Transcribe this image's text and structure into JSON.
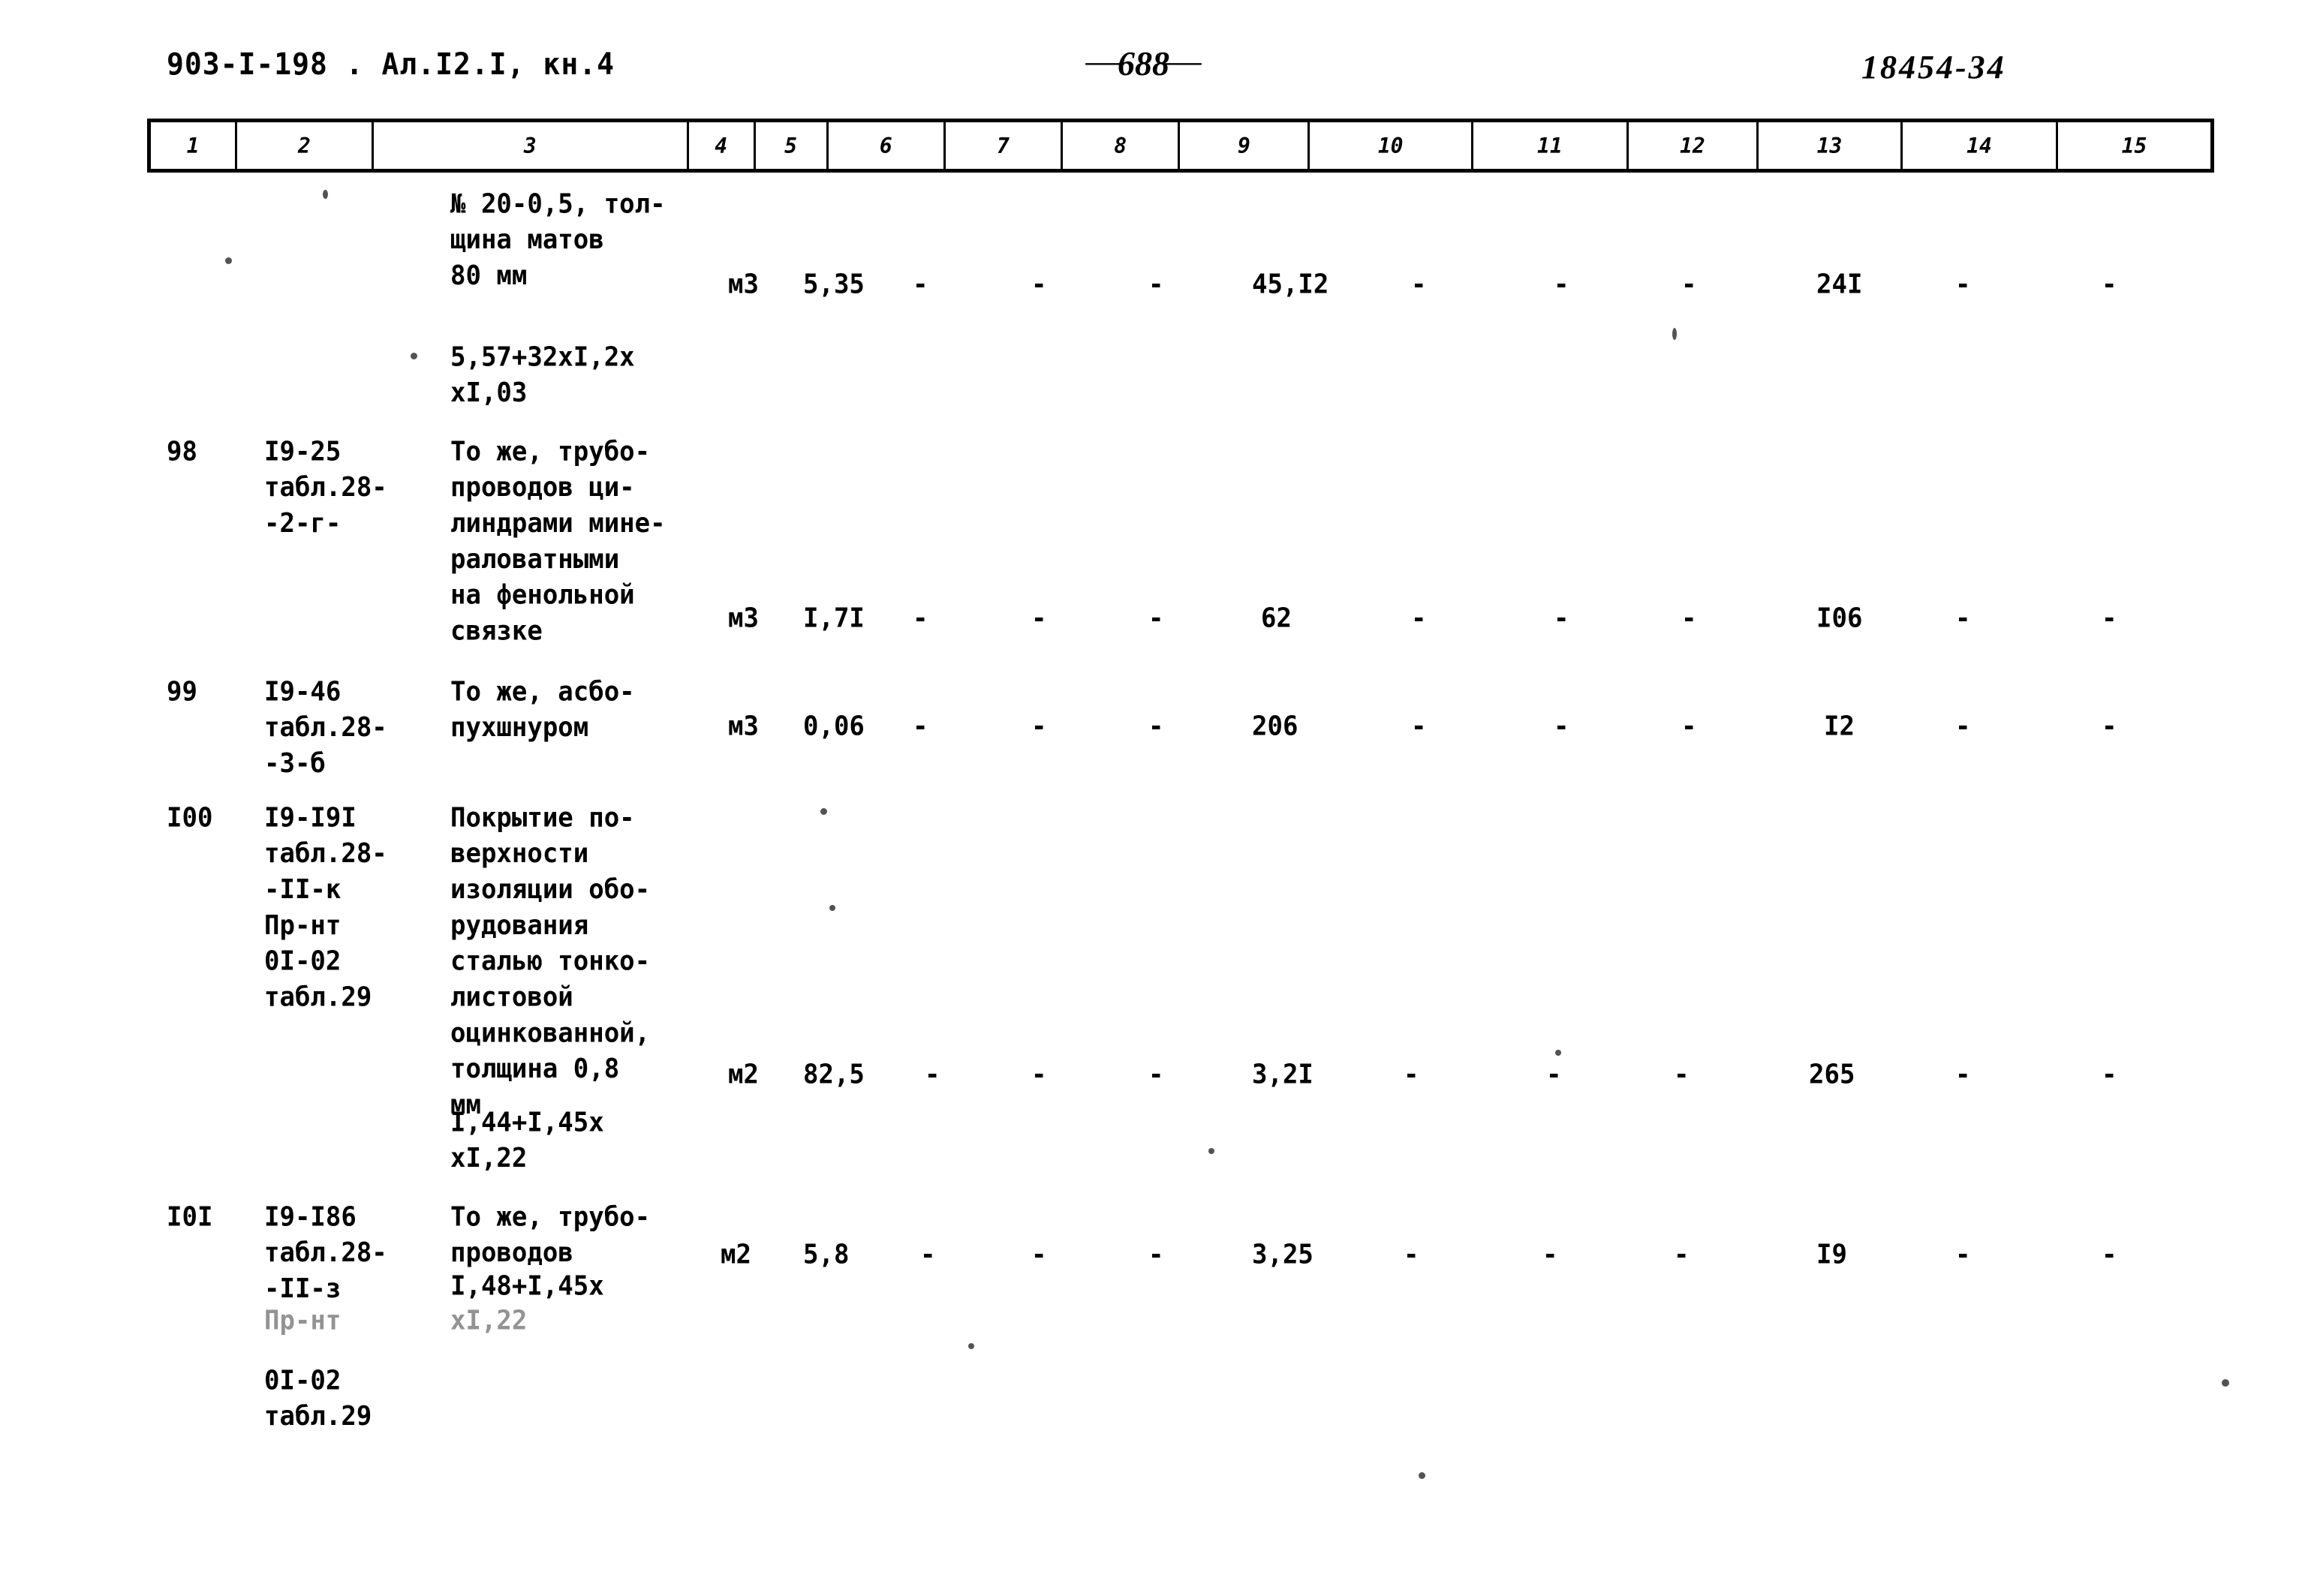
{
  "header": {
    "doc_code": "903-I-198 . Ал.I2.I, кн.4",
    "page_number": "688",
    "dash_left": "—",
    "dash_right": "—",
    "archive_stamp": "18454-34"
  },
  "table": {
    "column_headers": [
      "1",
      "2",
      "3",
      "4",
      "5",
      "6",
      "7",
      "8",
      "9",
      "10",
      "11",
      "12",
      "13",
      "14",
      "15"
    ],
    "rows": [
      {
        "num": "",
        "code": "",
        "description": "№ 20-0,5, тол-\nщина матов\n80 мм",
        "formula": "5,57+32xI,2x\nxI,03",
        "unit": "м3",
        "c5": "5,35",
        "c6": "-",
        "c7": "-",
        "c8": "-",
        "c9": "45,I2",
        "c10": "-",
        "c11": "-",
        "c12": "-",
        "c13": "24I",
        "c14": "-",
        "c15": "-"
      },
      {
        "num": "98",
        "code": "I9-25\nтабл.28-\n-2-г-",
        "description": "То же, трубо-\nпроводов ци-\nлиндрами мине-\nраловатными\nна фенольной\nсвязке",
        "formula": "",
        "unit": "м3",
        "c5": "I,7I",
        "c6": "-",
        "c7": "-",
        "c8": "-",
        "c9": "62",
        "c10": "-",
        "c11": "-",
        "c12": "-",
        "c13": "I06",
        "c14": "-",
        "c15": "-"
      },
      {
        "num": "99",
        "code": "I9-46\nтабл.28-\n-3-б",
        "description": "То же, асбо-\nпухшнуром",
        "formula": "",
        "unit": "м3",
        "c5": "0,06",
        "c6": "-",
        "c7": "-",
        "c8": "-",
        "c9": "206",
        "c10": "-",
        "c11": "-",
        "c12": "-",
        "c13": "I2",
        "c14": "-",
        "c15": "-"
      },
      {
        "num": "I00",
        "code": "I9-I9I\nтабл.28-\n-II-к\nПр-нт\n0I-02\nтабл.29",
        "description": "Покрытие по-\nверхности\nизоляции обо-\nрудования\nсталью тонко-\nлистовой\nоцинкованной,\nтолщина 0,8\nмм",
        "formula": "I,44+I,45x\nxI,22",
        "unit": "м2",
        "c5": "82,5",
        "c6": "-",
        "c7": "-",
        "c8": "-",
        "c9": "3,2I",
        "c10": "-",
        "c11": "-",
        "c12": "-",
        "c13": "265",
        "c14": "-",
        "c15": "-"
      },
      {
        "num": "I0I",
        "code": "I9-I86\nтабл.28-\n-II-з",
        "code_faded": "Пр-нт",
        "code_tail": "0I-02\nтабл.29",
        "description": "То же, трубо-\nпроводов",
        "formula": "I,48+I,45x",
        "formula_faded": "xI,22",
        "unit": "м2",
        "c5": "5,8",
        "c6": "-",
        "c7": "-",
        "c8": "-",
        "c9": "3,25",
        "c10": "-",
        "c11": "-",
        "c12": "-",
        "c13": "I9",
        "c14": "-",
        "c15": "-"
      }
    ]
  }
}
